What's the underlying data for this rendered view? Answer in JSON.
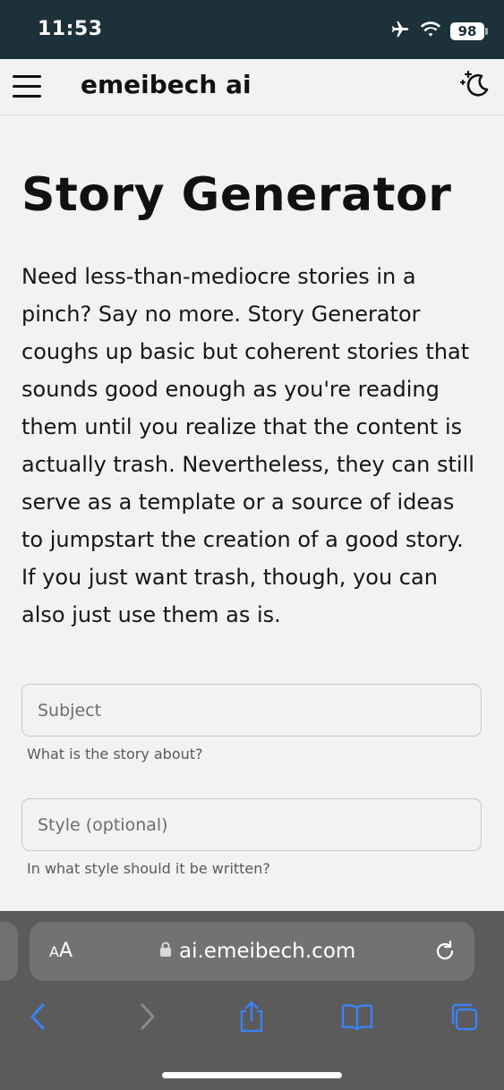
{
  "status_bar": {
    "time": "11:53",
    "battery": "98",
    "icons": [
      "airplane-icon",
      "wifi-icon",
      "battery-icon"
    ]
  },
  "header": {
    "brand": "emeibech ai",
    "menu_icon": "hamburger-icon",
    "theme_icon": "moon-stars-icon"
  },
  "main": {
    "title": "Story Generator",
    "intro": "Need less-than-mediocre stories in a pinch? Say no more. Story Generator coughs up basic but coherent stories that sounds good enough as you're reading them until you realize that the content is actually trash. Nevertheless, they can still serve as a template or a source of ideas to jumpstart the creation of a good story. If you just want trash, though, you can also just use them as is.",
    "fields": [
      {
        "placeholder": "Subject",
        "value": "",
        "helper": "What is the story about?"
      },
      {
        "placeholder": "Style (optional)",
        "value": "",
        "helper": "In what style should it be written?"
      }
    ]
  },
  "browser": {
    "aa_small": "A",
    "aa_large": "A",
    "url": "ai.emeibech.com",
    "colors": {
      "chrome": "#5b5b5b",
      "urlbar": "#727272",
      "accent": "#3b82f6",
      "status_bar": "#1c3139"
    }
  }
}
